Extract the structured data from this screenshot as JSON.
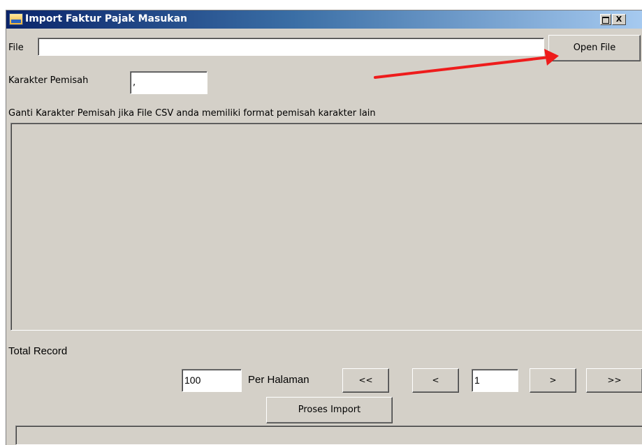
{
  "window": {
    "title": "Import Faktur Pajak Masukan",
    "close_glyph": "X",
    "app_icon": "tax-app-icon"
  },
  "file_row": {
    "label": "File",
    "value": "",
    "open_button": "Open File"
  },
  "separator": {
    "label": "Karakter Pemisah",
    "value": ","
  },
  "hint": "Ganti Karakter Pemisah jika File CSV anda memiliki format pemisah karakter lain",
  "total_record_label": "Total Record",
  "pagination": {
    "per_page_value": "100",
    "per_page_label": "Per Halaman",
    "first": "<<",
    "prev": "<",
    "page_value": "1",
    "next": ">",
    "last": ">>"
  },
  "process_button": "Proses Import",
  "annotation": {
    "arrow_color": "#ee1c1c"
  }
}
